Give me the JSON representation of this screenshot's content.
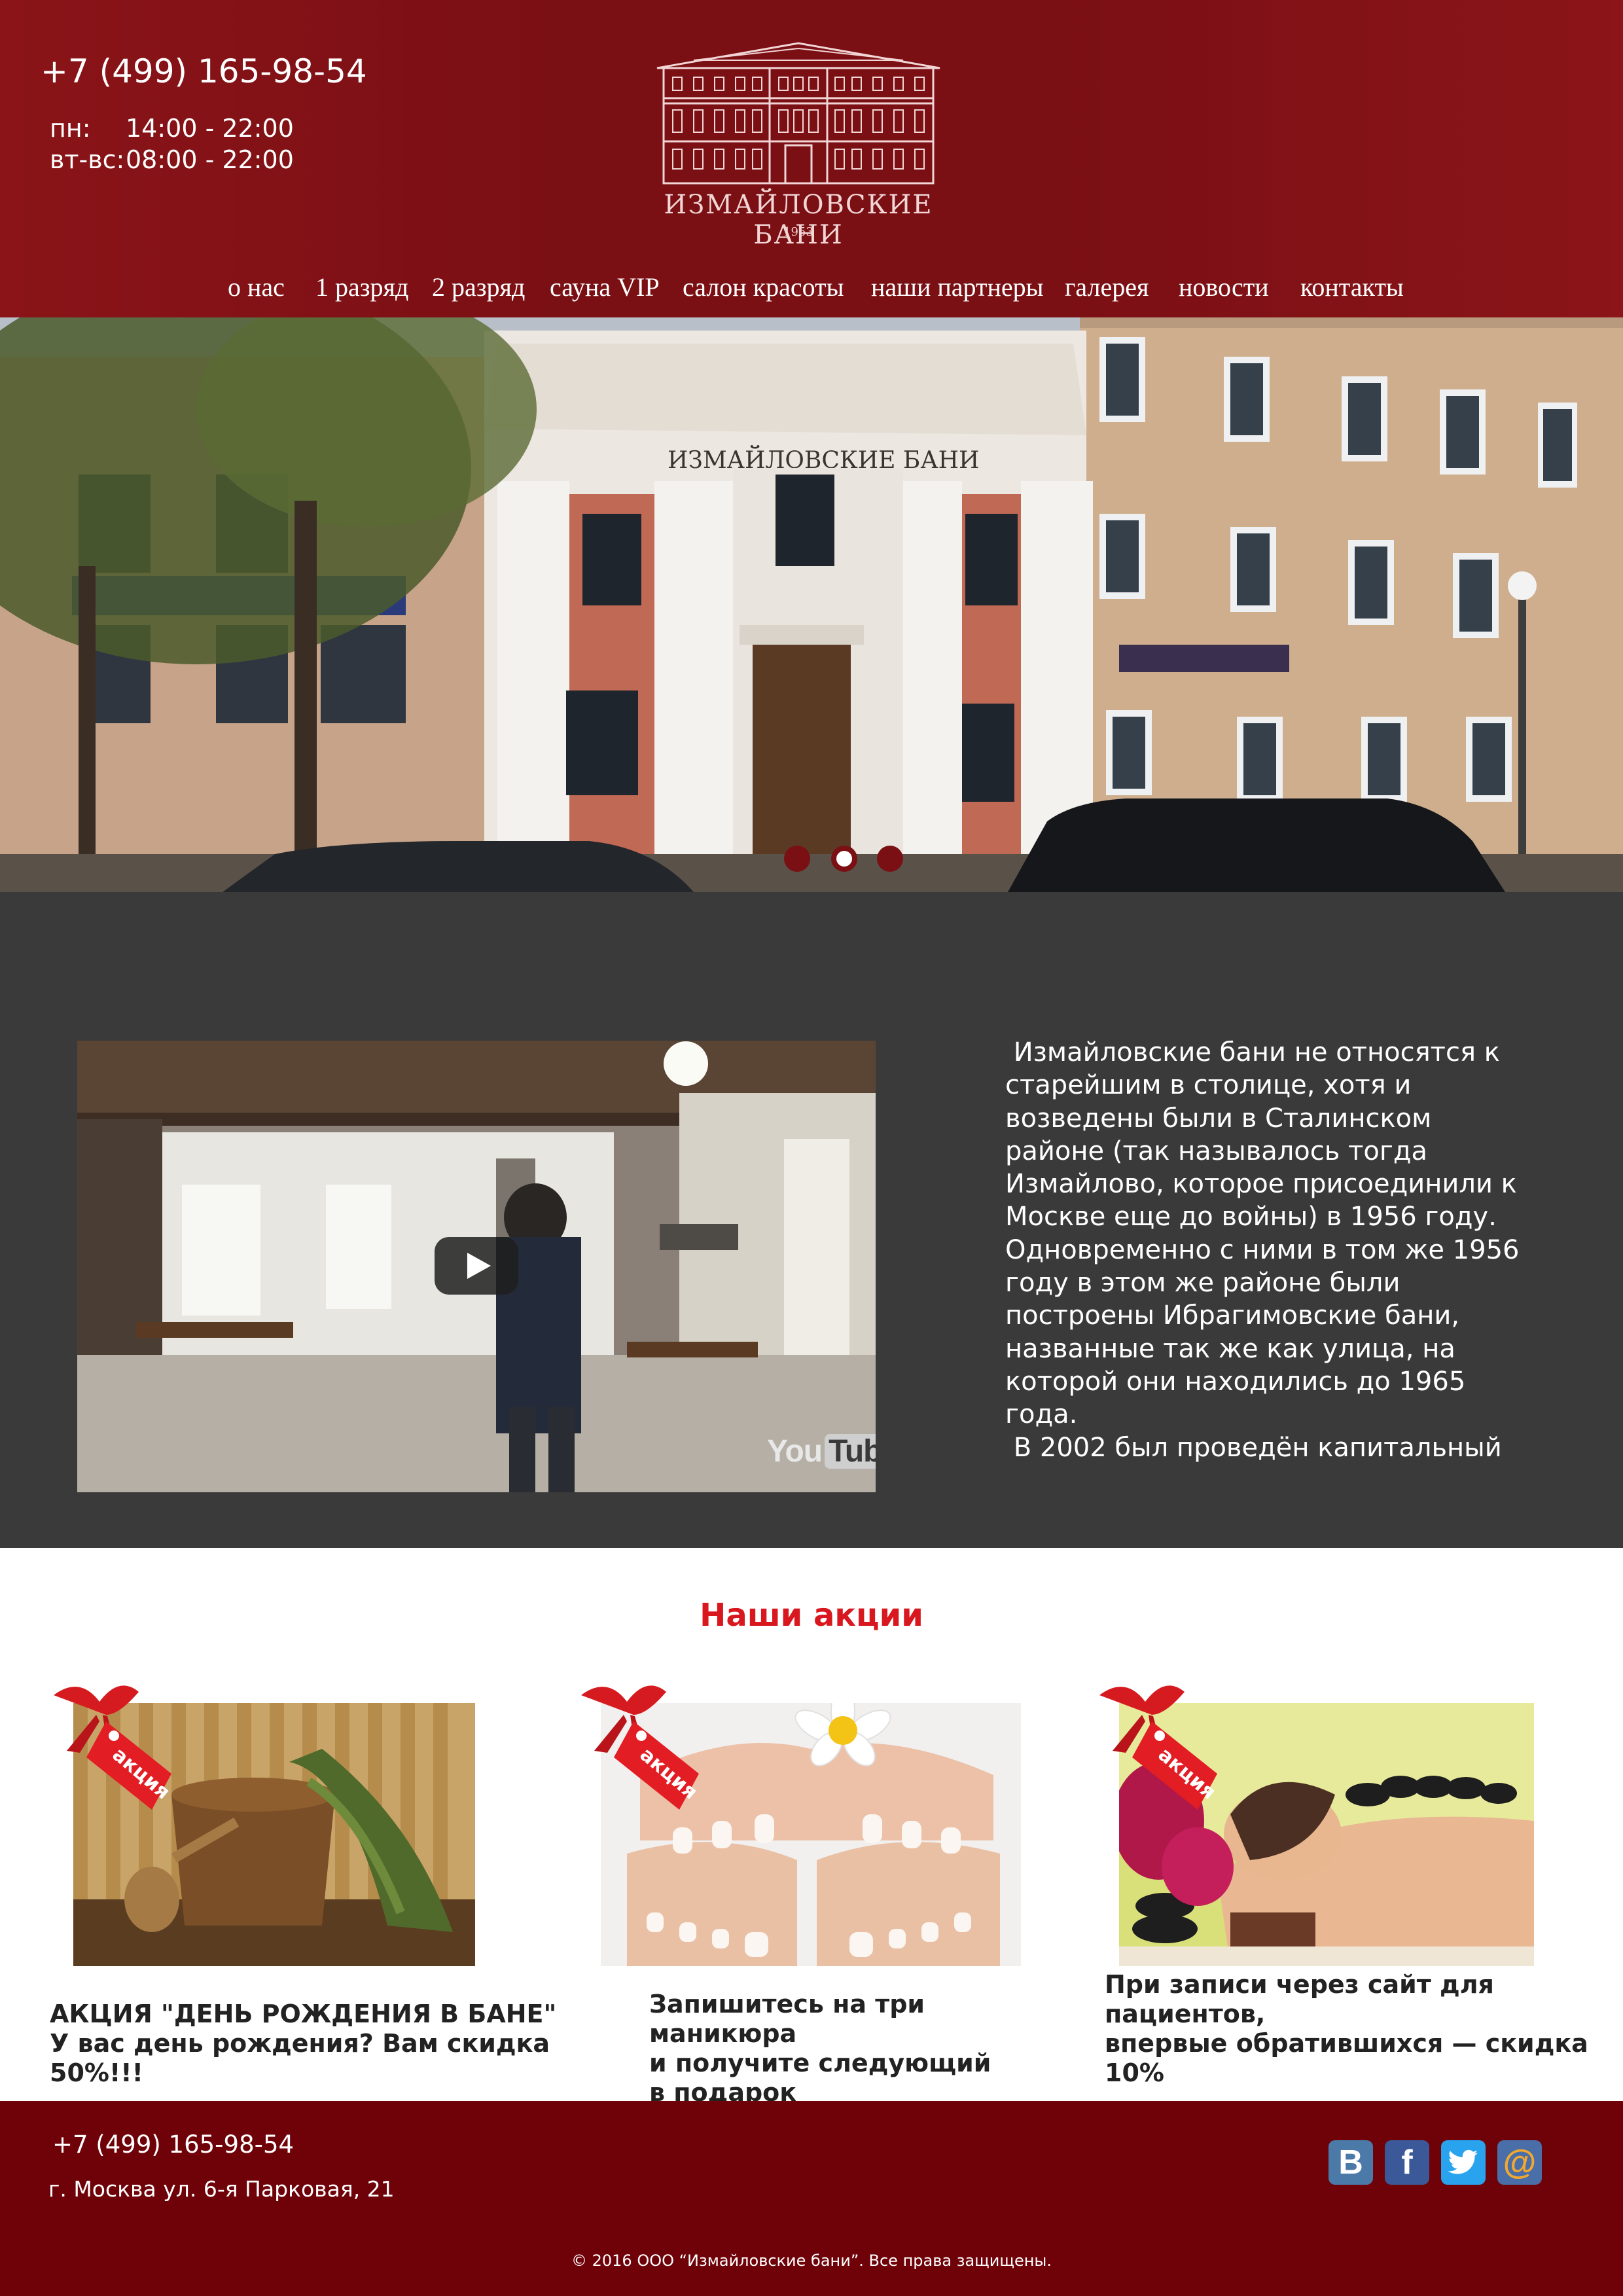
{
  "header": {
    "phone": "+7 (499) 165-98-54",
    "hours": [
      {
        "day": "пн:",
        "time": "14:00 - 22:00"
      },
      {
        "day": "вт-вс:",
        "time": "08:00 - 22:00"
      }
    ],
    "logo_title": "ИЗМАЙЛОВСКИЕ БАНИ",
    "logo_year": "1953"
  },
  "nav": {
    "items": [
      "о нас",
      "1 разряд",
      "2 разряд",
      "сауна VIP",
      "салон красоты",
      "наши партнеры",
      "галерея",
      "новости",
      "контакты"
    ]
  },
  "hero": {
    "sign_text": "ИЗМАЙЛОВСКИЕ БАНИ",
    "slide_count": 3,
    "active_slide": 2
  },
  "about": {
    "text": " Измайловские бани не относятся к\nстарейшим в столице, хотя и\nвозведены были в Сталинском\nрайоне (так называлось тогда\nИзмайлово, которое присоединили к\nМоскве еще до войны) в 1956 году.\nОдновременно с ними в том же 1956\nгоду в этом же районе были\nпостроены Ибрагимовские бани,\nназванные так же как улица, на\nкоторой они находились до 1965\nгода.\n В 2002 был проведён капитальный"
  },
  "video": {
    "brand": "You",
    "brand_tube": "Tube"
  },
  "promos": {
    "title": "Наши акции",
    "badge": "акция",
    "items": [
      {
        "text": "АКЦИЯ \"ДЕНЬ РОЖДЕНИЯ В БАНЕ\"\nУ вас день рождения? Вам скидка 50%!!!\n."
      },
      {
        "text": "Запишитесь на три маникюра\nи получите следующий\nв подарок"
      },
      {
        "text": "При записи через сайт для\nпациентов,\nвпервые обратившихся — скидка 10%"
      }
    ]
  },
  "footer": {
    "phone": "+7 (499) 165-98-54",
    "address": "г. Москва ул. 6-я Парковая, 21",
    "copyright": "© 2016 ООО “Измайловские бани”. Все права защищены.",
    "social": [
      {
        "name": "vk-icon",
        "glyph": "В",
        "color": "#4b79a8"
      },
      {
        "name": "facebook-icon",
        "glyph": "f",
        "color": "#3b5998"
      },
      {
        "name": "twitter-icon",
        "glyph": "",
        "color": "#2aa3ef"
      },
      {
        "name": "mail-icon",
        "glyph": "@",
        "color": "#4a6ea8"
      }
    ]
  }
}
